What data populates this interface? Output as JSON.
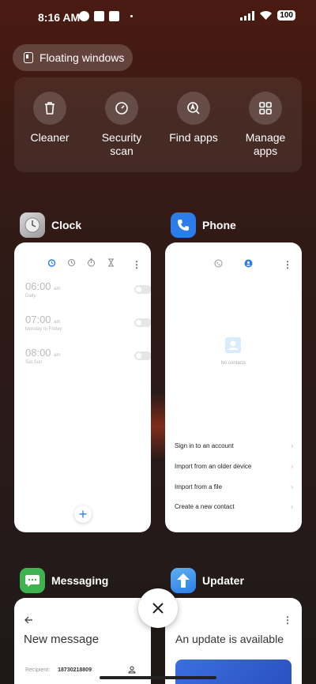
{
  "status": {
    "time": "8:16 AM",
    "battery": "100"
  },
  "floating_windows": {
    "label": "Floating windows"
  },
  "tools": [
    {
      "label": "Cleaner",
      "icon": "trash-icon"
    },
    {
      "label": "Security scan",
      "icon": "shield-icon"
    },
    {
      "label": "Find apps",
      "icon": "find-apps-icon"
    },
    {
      "label": "Manage apps",
      "icon": "grid-icon"
    }
  ],
  "apps": {
    "clock": {
      "name": "Clock",
      "alarms": [
        {
          "time": "06:00",
          "ampm": "am",
          "repeat": "Daily"
        },
        {
          "time": "07:00",
          "ampm": "am",
          "repeat": "Monday to Friday"
        },
        {
          "time": "08:00",
          "ampm": "am",
          "repeat": "Sat Sun"
        }
      ],
      "fab": "+"
    },
    "phone": {
      "name": "Phone",
      "empty_text": "No contacts",
      "actions": [
        "Sign in to an account",
        "Import from an older device",
        "Import from a file",
        "Create a new contact"
      ]
    },
    "messaging": {
      "name": "Messaging",
      "title": "New message",
      "recipient_label": "Recipient:",
      "recipient_value": "18730218809"
    },
    "updater": {
      "name": "Updater",
      "title": "An update is available"
    }
  },
  "colors": {
    "accent_blue": "#2b7de9",
    "messaging_green": "#3fb34f",
    "updater_blue": "#3a8fe0"
  }
}
